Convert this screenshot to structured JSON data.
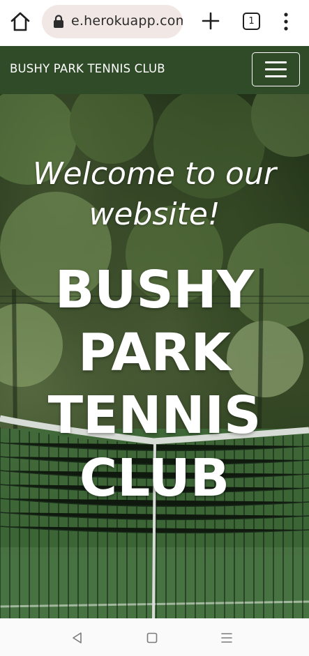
{
  "browser": {
    "url": "e.herokuapp.com",
    "tab_count": "1",
    "icons": {
      "home": "home-icon",
      "lock": "lock-icon",
      "new_tab": "plus-icon",
      "menu": "vertical-dots-icon"
    }
  },
  "site": {
    "brand": "BUSHY PARK TENNIS CLUB",
    "header_color": "#2f4b27",
    "nav_toggle_icon": "hamburger-icon"
  },
  "hero": {
    "welcome_lines": [
      "Welcome to our",
      "website!"
    ],
    "title_lines": [
      "BUSHY",
      "PARK",
      "TENNIS",
      "CLUB"
    ]
  },
  "system_nav": {
    "icons": [
      "back-icon",
      "home-square-icon",
      "recents-icon"
    ]
  }
}
